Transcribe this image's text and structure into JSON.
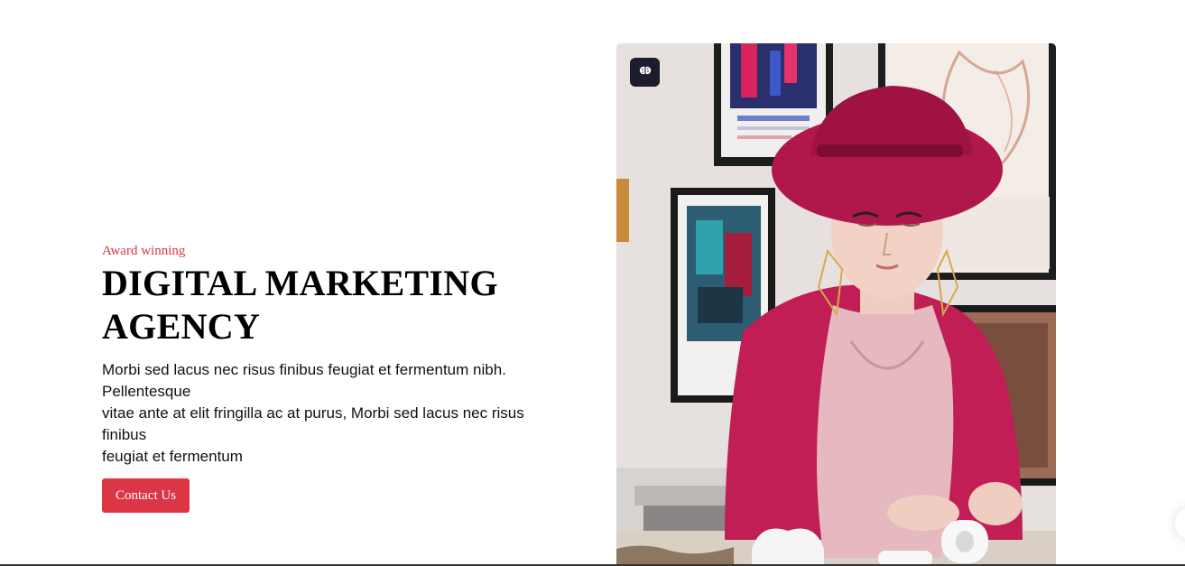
{
  "hero": {
    "eyebrow": "Award winning",
    "headline_line1": "DIGITAL MARKETING",
    "headline_line2": "AGENCY",
    "body_lines": [
      "Morbi sed lacus nec risus finibus feugiat et fermentum nibh.",
      "Pellentesque",
      "vitae ante at elit fringilla ac at purus, Morbi sed lacus nec risus",
      "finibus",
      "feugiat et fermentum"
    ],
    "cta_label": "Contact Us"
  },
  "image": {
    "subject": "woman-in-red-hat-photo",
    "badge_icon": "brain-icon"
  },
  "colors": {
    "accent": "#dc3545",
    "badge_bg": "#1c1c2e",
    "hat": "#b0174a",
    "cardigan": "#c01e55"
  }
}
